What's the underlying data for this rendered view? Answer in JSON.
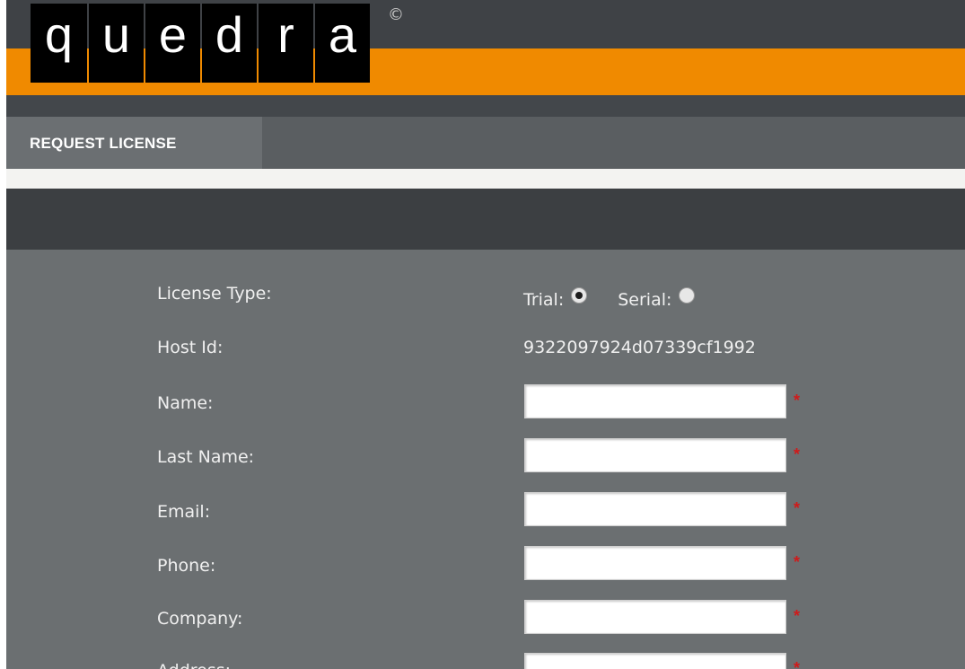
{
  "header": {
    "logo_letters": [
      "q",
      "u",
      "e",
      "d",
      "r",
      "a"
    ],
    "copyright_symbol": "©",
    "colors": {
      "header_bg": "#3e4144",
      "accent": "#f08a00"
    }
  },
  "nav": {
    "tab_label": "REQUEST LICENSE"
  },
  "form": {
    "license_type_label": "License Type:",
    "trial_label": "Trial:",
    "serial_label": "Serial:",
    "license_type_selected": "Trial",
    "host_id_label": "Host Id:",
    "host_id_value": "9322097924d07339cf1992",
    "name_label": "Name:",
    "last_name_label": "Last Name:",
    "email_label": "Email:",
    "phone_label": "Phone:",
    "company_label": "Company:",
    "address_label": "Address:",
    "required_marker": "*",
    "fields": {
      "name": "",
      "last_name": "",
      "email": "",
      "phone": "",
      "company": "",
      "address": ""
    }
  }
}
